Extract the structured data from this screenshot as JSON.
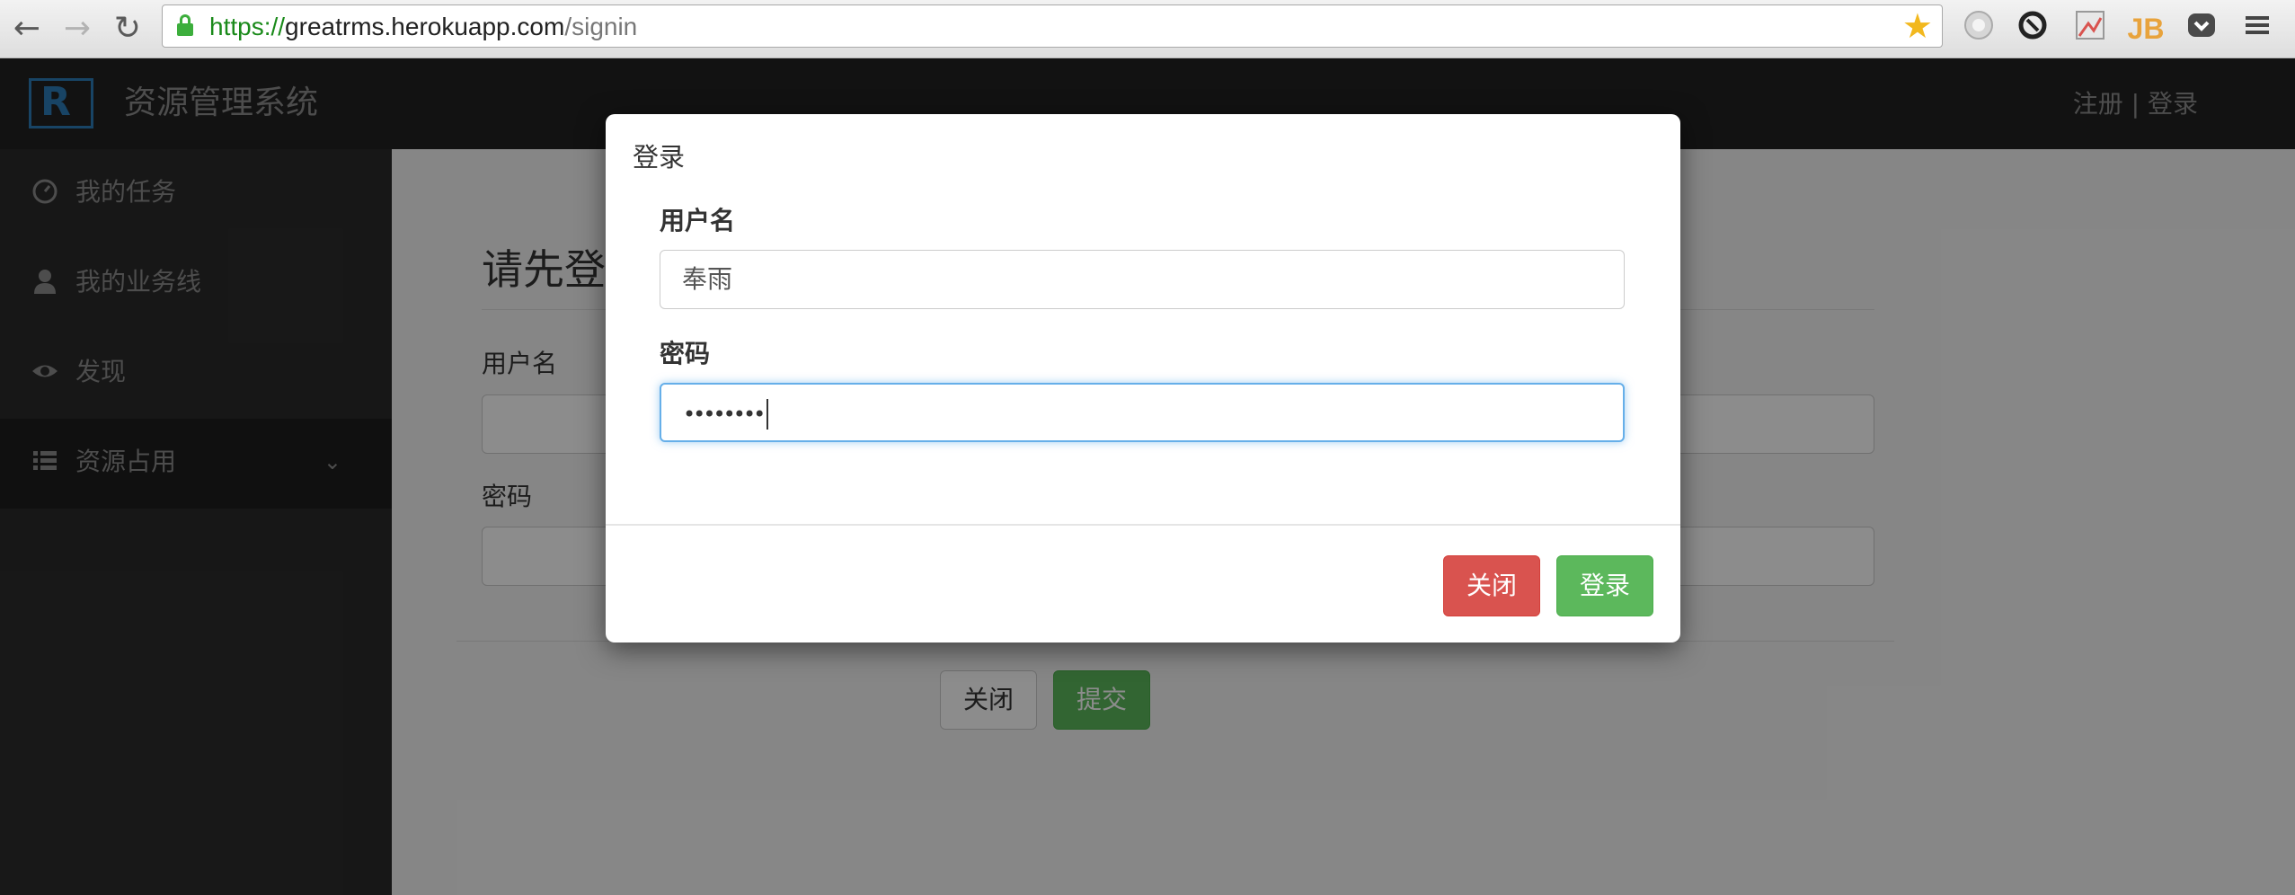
{
  "browser": {
    "url_scheme": "https://",
    "url_host": "greatrms.herokuapp.com",
    "url_path": "/signin",
    "icons": [
      "back-arrow-icon",
      "forward-arrow-icon",
      "reload-icon",
      "lock-icon",
      "bookmark-star-icon",
      "globe-extension-icon",
      "sync-extension-icon",
      "image-extension-icon",
      "jb-extension-icon",
      "pocket-extension-icon",
      "menu-icon"
    ]
  },
  "header": {
    "app_title": "资源管理系统",
    "auth_links": "注册 | 登录"
  },
  "sidebar": {
    "items": [
      {
        "label": "我的任务",
        "icon": "dashboard-icon"
      },
      {
        "label": "我的业务线",
        "icon": "user-icon"
      },
      {
        "label": "发现",
        "icon": "eye-icon"
      },
      {
        "label": "资源占用",
        "icon": "list-icon"
      }
    ]
  },
  "main": {
    "page_title": "请先登",
    "username_label": "用户名",
    "password_label": "密码",
    "close_button": "关闭",
    "submit_button": "提交"
  },
  "modal": {
    "title": "登录",
    "username_label": "用户名",
    "username_value": "奉雨",
    "password_label": "密码",
    "password_mask": "••••••••",
    "close_button": "关闭",
    "login_button": "登录"
  },
  "colors": {
    "primary": "#5cb85c",
    "danger": "#d9534f",
    "brand": "#2d7db8"
  }
}
